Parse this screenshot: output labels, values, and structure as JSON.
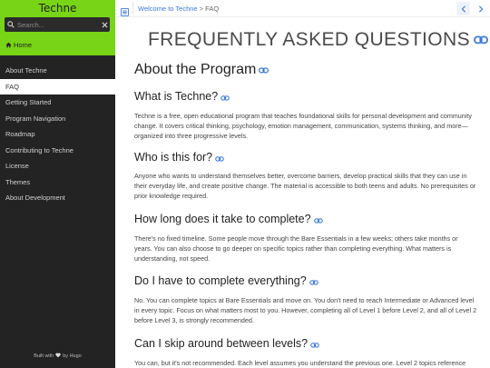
{
  "sidebar": {
    "site_title": "Techne",
    "search_placeholder": "Search...",
    "home_label": "Home",
    "items": [
      {
        "label": "About Techne"
      },
      {
        "label": "FAQ"
      },
      {
        "label": "Getting Started"
      },
      {
        "label": "Program Navigation"
      },
      {
        "label": "Roadmap"
      },
      {
        "label": "Contributing to Techne"
      },
      {
        "label": "License"
      },
      {
        "label": "Themes"
      },
      {
        "label": "About Development"
      }
    ],
    "active_item": "FAQ",
    "footer_prefix": "Built with",
    "footer_suffix": "by Hugo"
  },
  "topbar": {
    "breadcrumb_link": "Welcome to Techne",
    "breadcrumb_sep": " > ",
    "breadcrumb_current": "FAQ"
  },
  "main": {
    "title": "FREQUENTLY ASKED QUESTIONS",
    "section_heading": "About the Program",
    "questions": [
      {
        "q": "What is Techne?",
        "a": "Techne is a free, open educational program that teaches foundational skills for personal development and community change. It covers critical thinking, psychology, emotion management, communication, systems thinking, and more—organized into three progressive levels."
      },
      {
        "q": "Who is this for?",
        "a": "Anyone who wants to understand themselves better, overcome barriers, develop practical skills that they can use in their everyday life, and create positive change. The material is accessible to both teens and adults. No prerequisites or prior knowledge required."
      },
      {
        "q": "How long does it take to complete?",
        "a": "There's no fixed timeline. Some people move through the Bare Essentials in a few weeks; others take months or years. You can also choose to go deeper on specific topics rather than completing everything. What matters is understanding, not speed."
      },
      {
        "q": "Do I have to complete everything?",
        "a": "No. You can complete topics at Bare Essentials and move on. You don't need to reach Intermediate or Advanced level in every topic. Focus on what matters most to you. However, completing all of Level 1 before Level 2, and all of Level 2 before Level 3, is strongly recommended."
      },
      {
        "q": "Can I skip around between levels?",
        "a": "You can, but it's not recommended. Each level assumes you understand the previous one. Level 2 topics reference"
      }
    ]
  },
  "colors": {
    "brand_green": "#77d416",
    "sidebar_bg": "#232323",
    "link_blue": "#3d79d8"
  },
  "icons": [
    "search-icon",
    "close-icon",
    "home-icon",
    "toc-icon",
    "chevron-left-icon",
    "chevron-right-icon",
    "link-icon",
    "heart-icon"
  ]
}
